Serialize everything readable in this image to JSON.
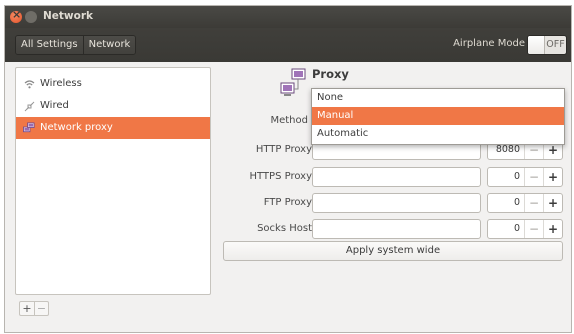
{
  "window": {
    "title": "Network"
  },
  "toolbar": {
    "breadcrumbs": [
      "All Settings",
      "Network"
    ],
    "airplane_label": "Airplane Mode",
    "airplane_state": "OFF"
  },
  "sidebar": {
    "items": [
      {
        "label": "Wireless",
        "icon": "wifi-icon"
      },
      {
        "label": "Wired",
        "icon": "wired-icon"
      },
      {
        "label": "Network proxy",
        "icon": "proxy-icon",
        "selected": true
      }
    ],
    "add_label": "+",
    "remove_label": "−"
  },
  "proxy": {
    "title": "Proxy",
    "method_label": "Method",
    "method_options": [
      "None",
      "Manual",
      "Automatic"
    ],
    "method_selected": "Manual",
    "fields": [
      {
        "label": "HTTP Proxy",
        "value": "",
        "port": "8080"
      },
      {
        "label": "HTTPS Proxy",
        "value": "",
        "port": "0"
      },
      {
        "label": "FTP Proxy",
        "value": "",
        "port": "0"
      },
      {
        "label": "Socks Host",
        "value": "",
        "port": "0"
      }
    ],
    "minus_label": "−",
    "plus_label": "+",
    "apply_label": "Apply system wide"
  },
  "colors": {
    "accent": "#f07746",
    "titlebar": "#3c3b37",
    "background": "#f2f1f0"
  }
}
